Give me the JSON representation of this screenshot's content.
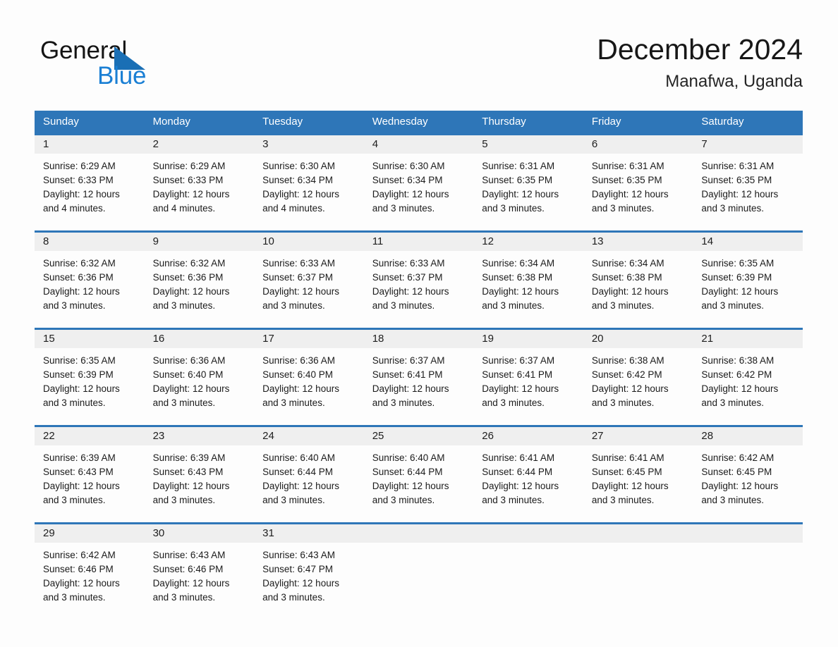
{
  "brand": {
    "line1": "General",
    "line2": "Blue",
    "logo_icon": "blue-triangle-logo",
    "accent_color": "#1a7fd4"
  },
  "header": {
    "title": "December 2024",
    "location": "Manafwa, Uganda"
  },
  "theme": {
    "header_blue": "#2e76b8",
    "daynum_gray": "#efefef",
    "page_background": "#fdfdfd"
  },
  "weekdays": [
    "Sunday",
    "Monday",
    "Tuesday",
    "Wednesday",
    "Thursday",
    "Friday",
    "Saturday"
  ],
  "weeks": [
    [
      {
        "day": "1",
        "sunrise": "Sunrise: 6:29 AM",
        "sunset": "Sunset: 6:33 PM",
        "daylight": "Daylight: 12 hours and 4 minutes."
      },
      {
        "day": "2",
        "sunrise": "Sunrise: 6:29 AM",
        "sunset": "Sunset: 6:33 PM",
        "daylight": "Daylight: 12 hours and 4 minutes."
      },
      {
        "day": "3",
        "sunrise": "Sunrise: 6:30 AM",
        "sunset": "Sunset: 6:34 PM",
        "daylight": "Daylight: 12 hours and 4 minutes."
      },
      {
        "day": "4",
        "sunrise": "Sunrise: 6:30 AM",
        "sunset": "Sunset: 6:34 PM",
        "daylight": "Daylight: 12 hours and 3 minutes."
      },
      {
        "day": "5",
        "sunrise": "Sunrise: 6:31 AM",
        "sunset": "Sunset: 6:35 PM",
        "daylight": "Daylight: 12 hours and 3 minutes."
      },
      {
        "day": "6",
        "sunrise": "Sunrise: 6:31 AM",
        "sunset": "Sunset: 6:35 PM",
        "daylight": "Daylight: 12 hours and 3 minutes."
      },
      {
        "day": "7",
        "sunrise": "Sunrise: 6:31 AM",
        "sunset": "Sunset: 6:35 PM",
        "daylight": "Daylight: 12 hours and 3 minutes."
      }
    ],
    [
      {
        "day": "8",
        "sunrise": "Sunrise: 6:32 AM",
        "sunset": "Sunset: 6:36 PM",
        "daylight": "Daylight: 12 hours and 3 minutes."
      },
      {
        "day": "9",
        "sunrise": "Sunrise: 6:32 AM",
        "sunset": "Sunset: 6:36 PM",
        "daylight": "Daylight: 12 hours and 3 minutes."
      },
      {
        "day": "10",
        "sunrise": "Sunrise: 6:33 AM",
        "sunset": "Sunset: 6:37 PM",
        "daylight": "Daylight: 12 hours and 3 minutes."
      },
      {
        "day": "11",
        "sunrise": "Sunrise: 6:33 AM",
        "sunset": "Sunset: 6:37 PM",
        "daylight": "Daylight: 12 hours and 3 minutes."
      },
      {
        "day": "12",
        "sunrise": "Sunrise: 6:34 AM",
        "sunset": "Sunset: 6:38 PM",
        "daylight": "Daylight: 12 hours and 3 minutes."
      },
      {
        "day": "13",
        "sunrise": "Sunrise: 6:34 AM",
        "sunset": "Sunset: 6:38 PM",
        "daylight": "Daylight: 12 hours and 3 minutes."
      },
      {
        "day": "14",
        "sunrise": "Sunrise: 6:35 AM",
        "sunset": "Sunset: 6:39 PM",
        "daylight": "Daylight: 12 hours and 3 minutes."
      }
    ],
    [
      {
        "day": "15",
        "sunrise": "Sunrise: 6:35 AM",
        "sunset": "Sunset: 6:39 PM",
        "daylight": "Daylight: 12 hours and 3 minutes."
      },
      {
        "day": "16",
        "sunrise": "Sunrise: 6:36 AM",
        "sunset": "Sunset: 6:40 PM",
        "daylight": "Daylight: 12 hours and 3 minutes."
      },
      {
        "day": "17",
        "sunrise": "Sunrise: 6:36 AM",
        "sunset": "Sunset: 6:40 PM",
        "daylight": "Daylight: 12 hours and 3 minutes."
      },
      {
        "day": "18",
        "sunrise": "Sunrise: 6:37 AM",
        "sunset": "Sunset: 6:41 PM",
        "daylight": "Daylight: 12 hours and 3 minutes."
      },
      {
        "day": "19",
        "sunrise": "Sunrise: 6:37 AM",
        "sunset": "Sunset: 6:41 PM",
        "daylight": "Daylight: 12 hours and 3 minutes."
      },
      {
        "day": "20",
        "sunrise": "Sunrise: 6:38 AM",
        "sunset": "Sunset: 6:42 PM",
        "daylight": "Daylight: 12 hours and 3 minutes."
      },
      {
        "day": "21",
        "sunrise": "Sunrise: 6:38 AM",
        "sunset": "Sunset: 6:42 PM",
        "daylight": "Daylight: 12 hours and 3 minutes."
      }
    ],
    [
      {
        "day": "22",
        "sunrise": "Sunrise: 6:39 AM",
        "sunset": "Sunset: 6:43 PM",
        "daylight": "Daylight: 12 hours and 3 minutes."
      },
      {
        "day": "23",
        "sunrise": "Sunrise: 6:39 AM",
        "sunset": "Sunset: 6:43 PM",
        "daylight": "Daylight: 12 hours and 3 minutes."
      },
      {
        "day": "24",
        "sunrise": "Sunrise: 6:40 AM",
        "sunset": "Sunset: 6:44 PM",
        "daylight": "Daylight: 12 hours and 3 minutes."
      },
      {
        "day": "25",
        "sunrise": "Sunrise: 6:40 AM",
        "sunset": "Sunset: 6:44 PM",
        "daylight": "Daylight: 12 hours and 3 minutes."
      },
      {
        "day": "26",
        "sunrise": "Sunrise: 6:41 AM",
        "sunset": "Sunset: 6:44 PM",
        "daylight": "Daylight: 12 hours and 3 minutes."
      },
      {
        "day": "27",
        "sunrise": "Sunrise: 6:41 AM",
        "sunset": "Sunset: 6:45 PM",
        "daylight": "Daylight: 12 hours and 3 minutes."
      },
      {
        "day": "28",
        "sunrise": "Sunrise: 6:42 AM",
        "sunset": "Sunset: 6:45 PM",
        "daylight": "Daylight: 12 hours and 3 minutes."
      }
    ],
    [
      {
        "day": "29",
        "sunrise": "Sunrise: 6:42 AM",
        "sunset": "Sunset: 6:46 PM",
        "daylight": "Daylight: 12 hours and 3 minutes."
      },
      {
        "day": "30",
        "sunrise": "Sunrise: 6:43 AM",
        "sunset": "Sunset: 6:46 PM",
        "daylight": "Daylight: 12 hours and 3 minutes."
      },
      {
        "day": "31",
        "sunrise": "Sunrise: 6:43 AM",
        "sunset": "Sunset: 6:47 PM",
        "daylight": "Daylight: 12 hours and 3 minutes."
      },
      {
        "day": "",
        "sunrise": "",
        "sunset": "",
        "daylight": ""
      },
      {
        "day": "",
        "sunrise": "",
        "sunset": "",
        "daylight": ""
      },
      {
        "day": "",
        "sunrise": "",
        "sunset": "",
        "daylight": ""
      },
      {
        "day": "",
        "sunrise": "",
        "sunset": "",
        "daylight": ""
      }
    ]
  ]
}
